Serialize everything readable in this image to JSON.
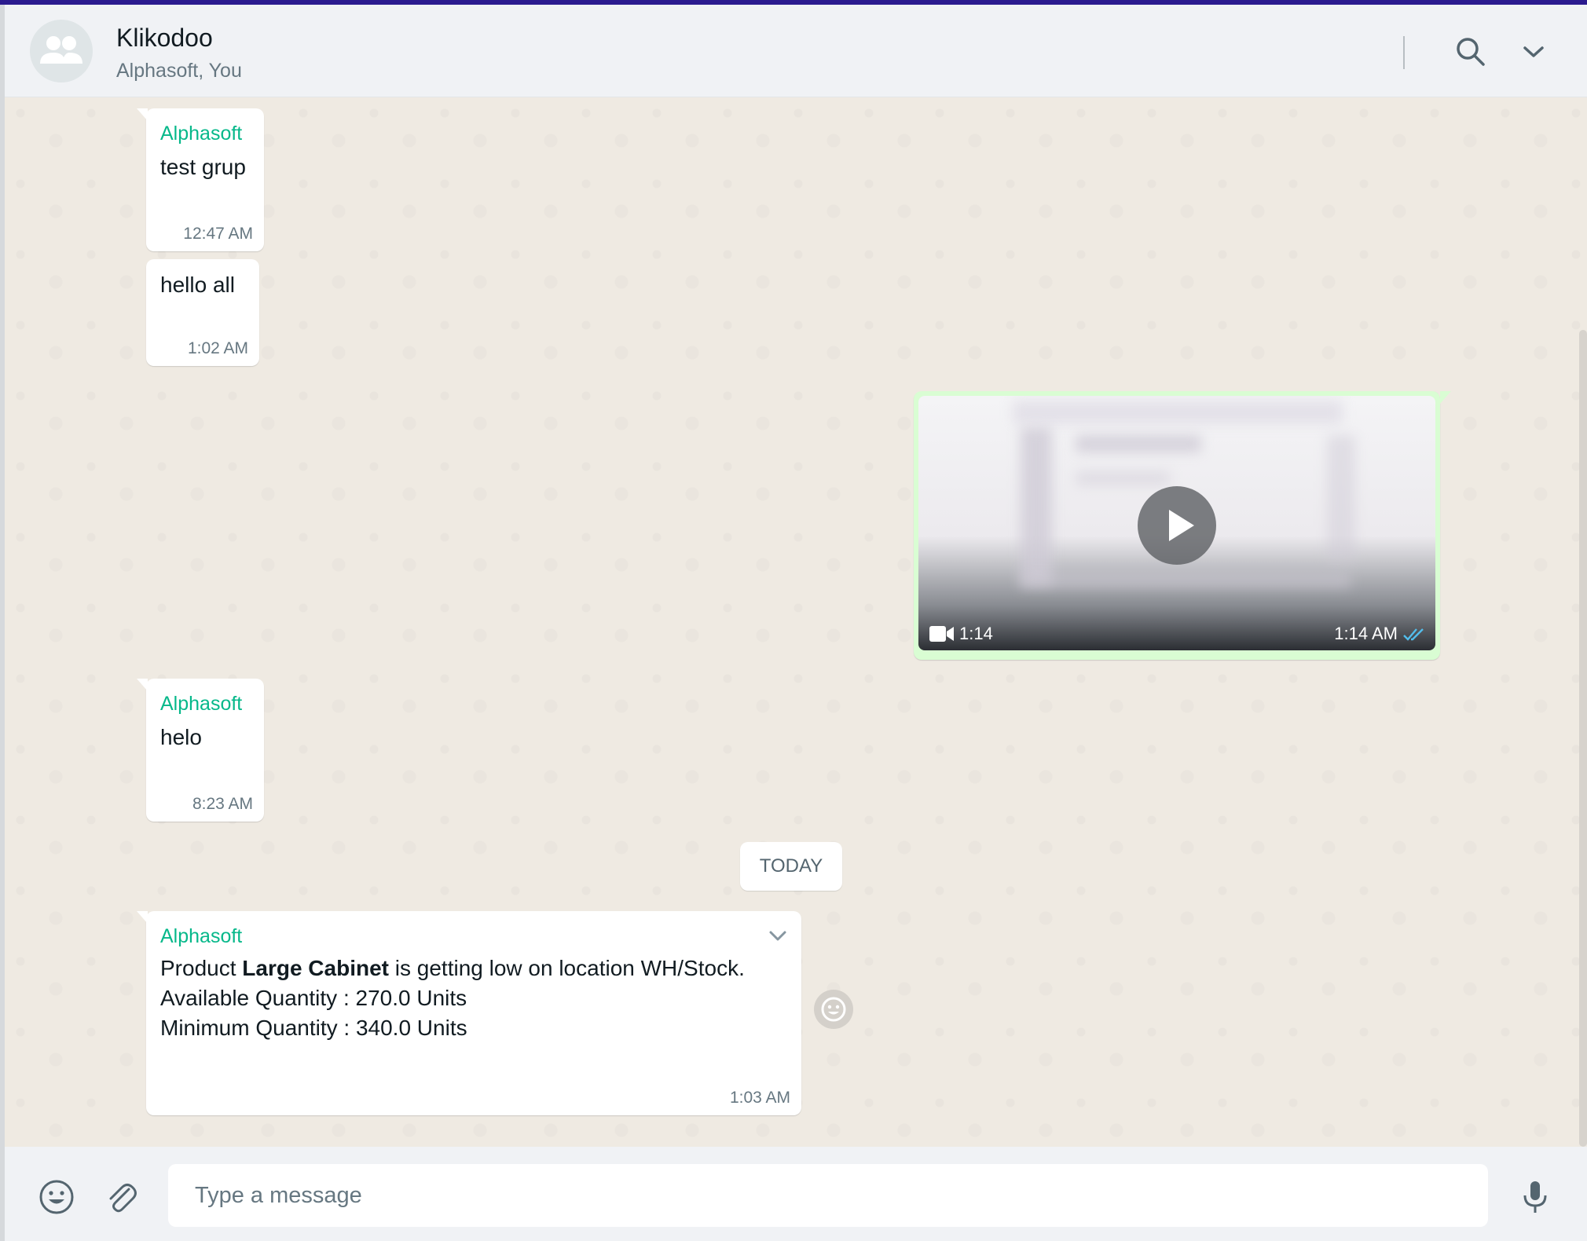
{
  "header": {
    "title": "Klikodoo",
    "subtitle": "Alphasoft, You",
    "icons": {
      "avatar": "group-avatar-icon",
      "search": "search-icon",
      "menu": "chevron-down-icon"
    }
  },
  "messages": [
    {
      "sender": "Alphasoft",
      "text": "test grup",
      "time": "12:47 AM"
    },
    {
      "text": "hello all",
      "time": "1:02 AM"
    },
    {
      "type": "video",
      "duration": "1:14",
      "time": "1:14 AM",
      "status": "read"
    },
    {
      "sender": "Alphasoft",
      "text": "helo",
      "time": "8:23 AM"
    }
  ],
  "date_divider": "TODAY",
  "alert_message": {
    "sender": "Alphasoft",
    "line1_prefix": "Product ",
    "line1_bold": "Large Cabinet",
    "line1_suffix": " is getting low on location WH/Stock.",
    "line2": "Available Quantity : 270.0 Units",
    "line3": "Minimum Quantity : 340.0 Units",
    "time": "1:03 AM"
  },
  "composer": {
    "placeholder": "Type a message",
    "icons": {
      "emoji": "emoji-icon",
      "attach": "paperclip-icon",
      "mic": "microphone-icon"
    }
  },
  "colors": {
    "sender": "#06b88a",
    "chat_bg": "#efeae2",
    "outgoing_bubble": "#d9fdd3",
    "read_ticks": "#53bdeb",
    "accent_bar": "#2b1b8f"
  }
}
